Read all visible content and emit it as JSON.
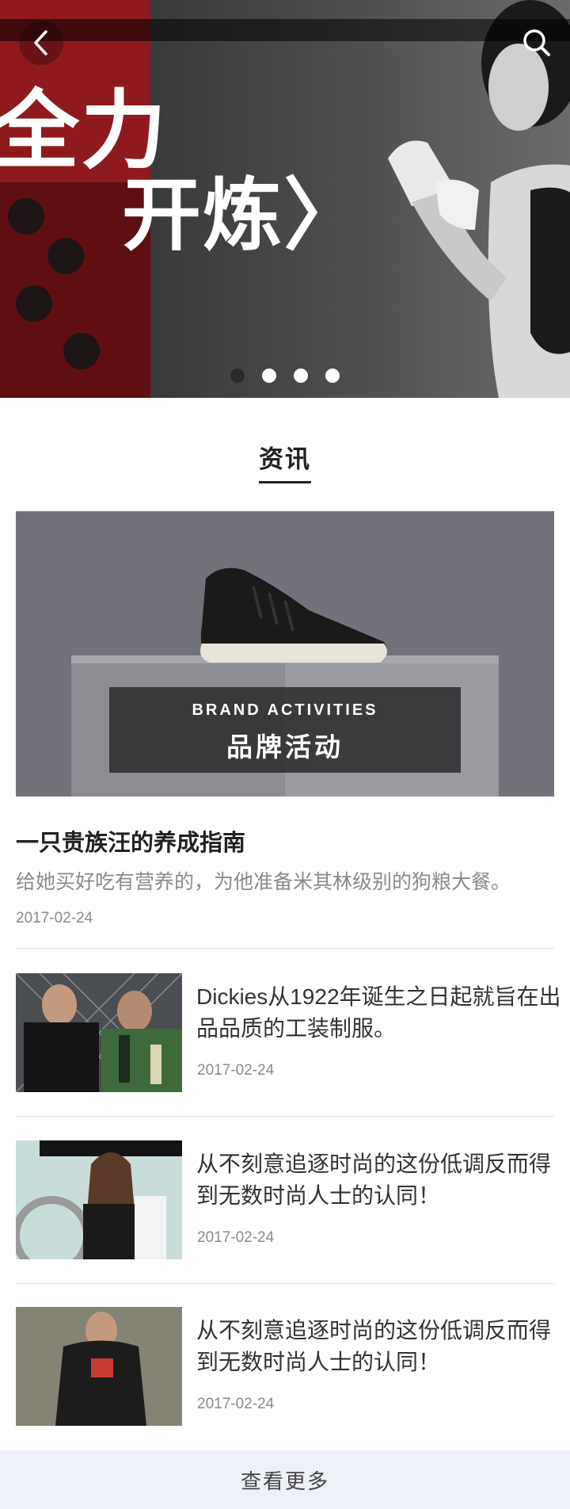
{
  "hero": {
    "headline_line1": "全力",
    "headline_line2": "开炼〉",
    "slide_count": 4,
    "active_slide": 1
  },
  "header": {
    "back_icon": "chevron-left-icon",
    "search_icon": "search-icon"
  },
  "section": {
    "title": "资讯"
  },
  "featured": {
    "banner_en": "BRAND ACTIVITIES",
    "banner_cn": "品牌活动",
    "title": "一只贵族汪的养成指南",
    "description": "给她买好吃有营养的，为他准备米其林级别的狗粮大餐。",
    "date": "2017-02-24"
  },
  "articles": [
    {
      "title": "Dickies从1922年诞生之日起就旨在出品品质的工装制服。",
      "date": "2017-02-24"
    },
    {
      "title": "从不刻意追逐时尚的这份低调反而得到无数时尚人士的认同！",
      "date": "2017-02-24"
    },
    {
      "title": "从不刻意追逐时尚的这份低调反而得到无数时尚人士的认同！",
      "date": "2017-02-24"
    }
  ],
  "footer": {
    "load_more_label": "查看更多"
  },
  "colors": {
    "accent_dark": "#222222",
    "muted_text": "#8a8a8a",
    "load_more_bg": "#edf0f6",
    "hero_red": "#8e1a1e"
  }
}
